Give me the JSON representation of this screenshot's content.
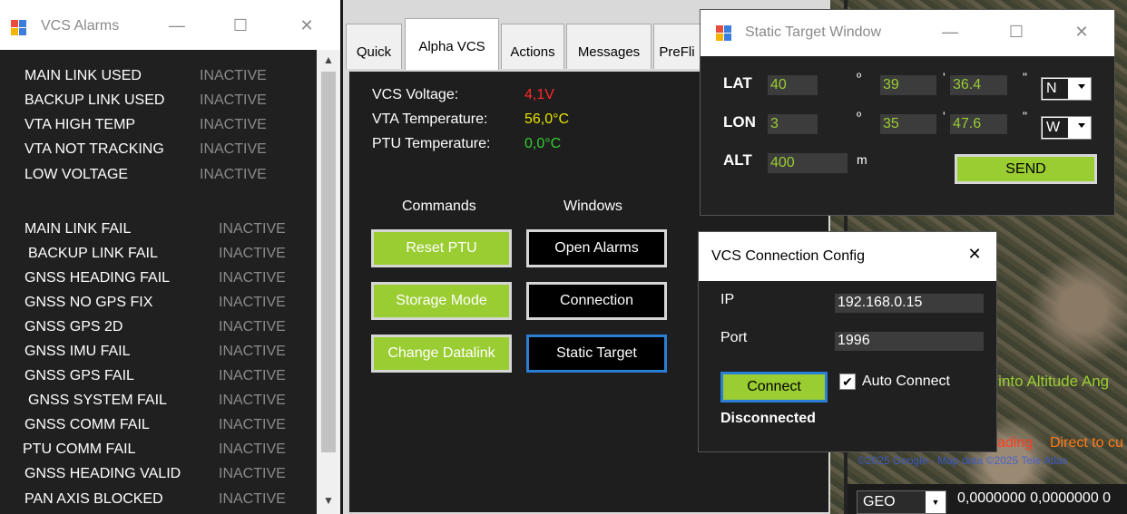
{
  "alarms_window": {
    "title": "VCS Alarms",
    "min_glyph": "—",
    "max_glyph": "☐",
    "close_glyph": "✕",
    "group1": [
      {
        "label": "MAIN LINK USED",
        "state": "INACTIVE"
      },
      {
        "label": "BACKUP LINK USED",
        "state": "INACTIVE"
      },
      {
        "label": "VTA HIGH TEMP",
        "state": "INACTIVE"
      },
      {
        "label": "VTA NOT TRACKING",
        "state": "INACTIVE"
      },
      {
        "label": "LOW VOLTAGE",
        "state": "INACTIVE"
      }
    ],
    "group2": [
      {
        "label": "MAIN LINK FAIL",
        "state": "INACTIVE"
      },
      {
        "label": "BACKUP LINK FAIL",
        "state": "INACTIVE"
      },
      {
        "label": "GNSS HEADING FAIL",
        "state": "INACTIVE"
      },
      {
        "label": "GNSS NO GPS FIX",
        "state": "INACTIVE"
      },
      {
        "label": "GNSS GPS 2D",
        "state": "INACTIVE"
      },
      {
        "label": "GNSS IMU FAIL",
        "state": "INACTIVE"
      },
      {
        "label": "GNSS GPS FAIL",
        "state": "INACTIVE"
      },
      {
        "label": "GNSS SYSTEM FAIL",
        "state": "INACTIVE"
      },
      {
        "label": "GNSS COMM FAIL",
        "state": "INACTIVE"
      },
      {
        "label": "PTU COMM FAIL",
        "state": "INACTIVE"
      },
      {
        "label": "GNSS HEADING VALID",
        "state": "INACTIVE"
      },
      {
        "label": "PAN AXIS BLOCKED",
        "state": "INACTIVE"
      }
    ]
  },
  "main": {
    "tabs": [
      {
        "label": "Quick"
      },
      {
        "label": "Alpha VCS"
      },
      {
        "label": "Actions"
      },
      {
        "label": "Messages"
      },
      {
        "label": "PreFli"
      }
    ],
    "status": {
      "vcs_voltage_label": "VCS Voltage:",
      "vcs_voltage_value": "4,1V",
      "vta_temp_label": "VTA Temperature:",
      "vta_temp_value": "56,0°C",
      "ptu_temp_label": "PTU Temperature:",
      "ptu_temp_value": "0,0°C"
    },
    "commands_heading": "Commands",
    "windows_heading": "Windows",
    "commands": [
      "Reset PTU",
      "Storage Mode",
      "Change Datalink"
    ],
    "windows": [
      "Open Alarms",
      "Connection",
      "Static Target"
    ]
  },
  "static_target": {
    "title": "Static Target Window",
    "lat_label": "LAT",
    "lon_label": "LON",
    "alt_label": "ALT",
    "lat_deg": "40",
    "lat_min": "39",
    "lat_sec": "36.4",
    "lat_hemi": "N",
    "lon_deg": "3",
    "lon_min": "35",
    "lon_sec": "47.6",
    "lon_hemi": "W",
    "alt_value": "400",
    "alt_unit": "m",
    "deg_symbol": "º",
    "min_symbol": "'",
    "sec_symbol": "\"",
    "send_label": "SEND"
  },
  "connection_config": {
    "title": "VCS Connection Config",
    "close_glyph": "✕",
    "ip_label": "IP",
    "ip_value": "192.168.0.15",
    "port_label": "Port",
    "port_value": "1996",
    "connect_label": "Connect",
    "auto_connect_label": "Auto Connect",
    "auto_connect_checked": true,
    "status": "Disconnected"
  },
  "map": {
    "altitude_text": "n into Altitude Ang",
    "heading_text": "ading",
    "direct_text": "Direct to cu",
    "credit_text": "©2025 Google - Map data ©2025 Tele Atlas",
    "geo_select": "GEO",
    "coords_text": "0,0000000 0,0000000  0"
  },
  "colors": {
    "accent_green": "#9acd32",
    "alert_red": "#ff2a2a",
    "warn_yellow": "#e6e600",
    "ok_green": "#32cd32",
    "focus_blue": "#2a7fd4"
  }
}
